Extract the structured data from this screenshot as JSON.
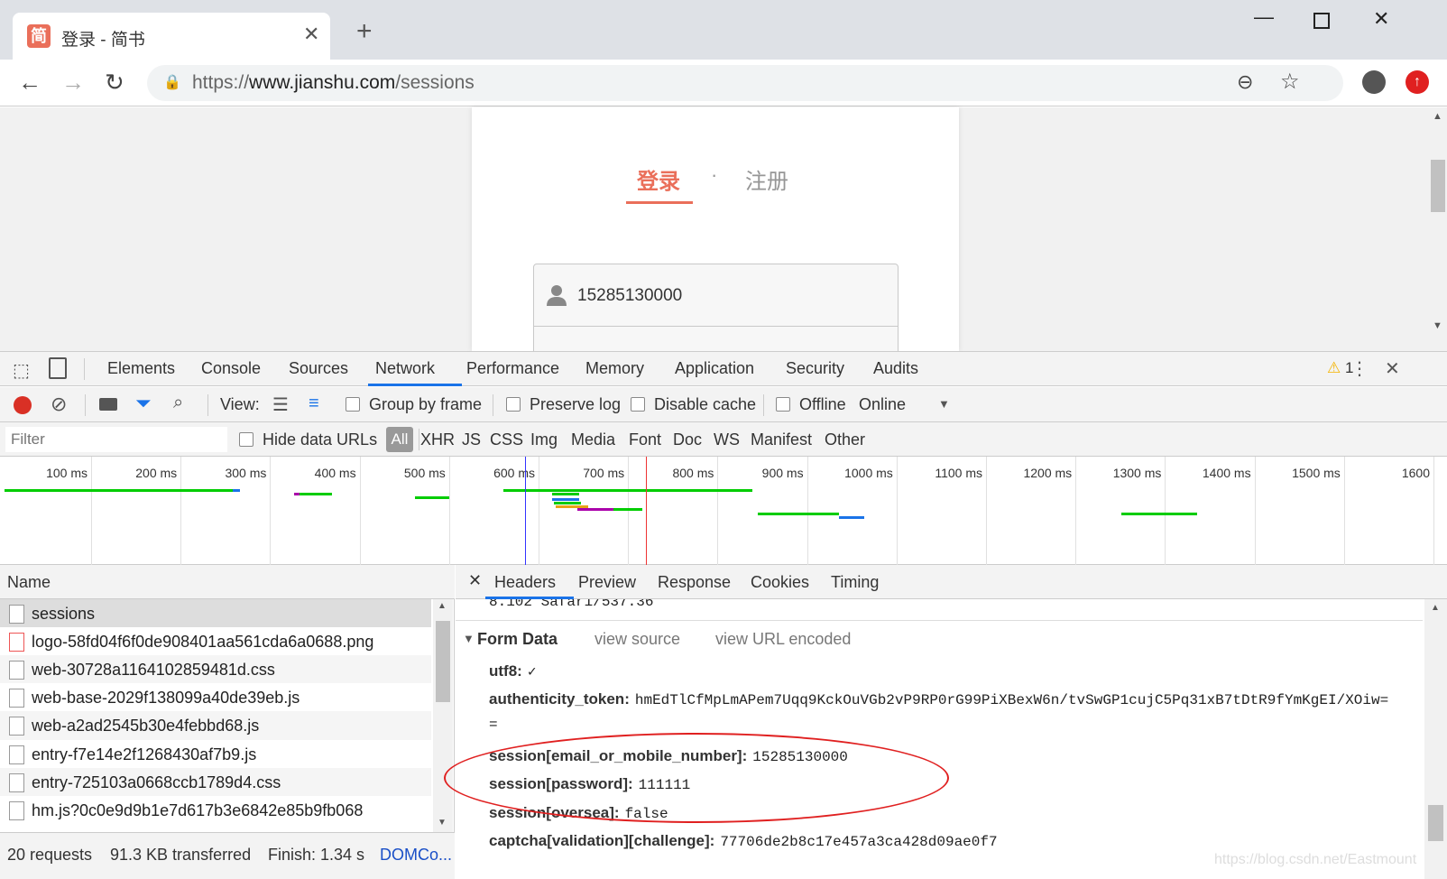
{
  "browser": {
    "tab_title": "登录 - 简书",
    "tab_favicon_text": "简",
    "url_prefix": "https://",
    "url_host": "www.jianshu.com",
    "url_path": "/sessions"
  },
  "page": {
    "login_tab": "登录",
    "separator": "·",
    "register_tab": "注册",
    "phone_value": "15285130000"
  },
  "devtools": {
    "tabs": [
      "Elements",
      "Console",
      "Sources",
      "Network",
      "Performance",
      "Memory",
      "Application",
      "Security",
      "Audits"
    ],
    "active_tab": "Network",
    "warning_count": "1",
    "toolbar": {
      "view_label": "View:",
      "group_by_frame": "Group by frame",
      "preserve_log": "Preserve log",
      "disable_cache": "Disable cache",
      "offline": "Offline",
      "throttle": "Online"
    },
    "filter": {
      "placeholder": "Filter",
      "hide_data_urls": "Hide data URLs",
      "types": [
        "All",
        "XHR",
        "JS",
        "CSS",
        "Img",
        "Media",
        "Font",
        "Doc",
        "WS",
        "Manifest",
        "Other"
      ],
      "active_type": "All"
    },
    "timeline": {
      "ticks": [
        "100 ms",
        "200 ms",
        "300 ms",
        "400 ms",
        "500 ms",
        "600 ms",
        "700 ms",
        "800 ms",
        "900 ms",
        "1000 ms",
        "1100 ms",
        "1200 ms",
        "1300 ms",
        "1400 ms",
        "1500 ms",
        "1600"
      ]
    },
    "name_header": "Name",
    "requests": [
      "sessions",
      "logo-58fd04f6f0de908401aa561cda6a0688.png",
      "web-30728a1164102859481d.css",
      "web-base-2029f138099a40de39eb.js",
      "web-a2ad2545b30e4febbd68.js",
      "entry-f7e14e2f1268430af7b9.js",
      "entry-725103a0668ccb1789d4.css",
      "hm.js?0c0e9d9b1e7d617b3e6842e85b9fb068"
    ],
    "status": {
      "requests": "20 requests",
      "transferred": "91.3 KB transferred",
      "finish": "Finish: 1.34 s",
      "dom": "DOMCo..."
    },
    "detail_tabs": [
      "Headers",
      "Preview",
      "Response",
      "Cookies",
      "Timing"
    ],
    "active_detail_tab": "Headers",
    "ua_tail": "8.102 Safari/537.36",
    "form_data": {
      "title": "Form Data",
      "view_source": "view source",
      "view_url_encoded": "view URL encoded",
      "fields": [
        {
          "key": "utf8:",
          "value": "✓"
        },
        {
          "key": "authenticity_token:",
          "value": "hmEdTlCfMpLmAPem7Uqq9KckOuVGb2vP9RP0rG99PiXBexW6n/tvSwGP1cujC5Pq31xB7tDtR9fYmKgEI/XOiw="
        },
        {
          "key": "",
          "value": "="
        },
        {
          "key": "session[email_or_mobile_number]:",
          "value": "15285130000"
        },
        {
          "key": "session[password]:",
          "value": "111111"
        },
        {
          "key": "session[oversea]:",
          "value": "false"
        },
        {
          "key": "captcha[validation][challenge]:",
          "value": "77706de2b8c17e457a3ca428d09ae0f7"
        }
      ]
    }
  },
  "watermark": "https://blog.csdn.net/Eastmount"
}
